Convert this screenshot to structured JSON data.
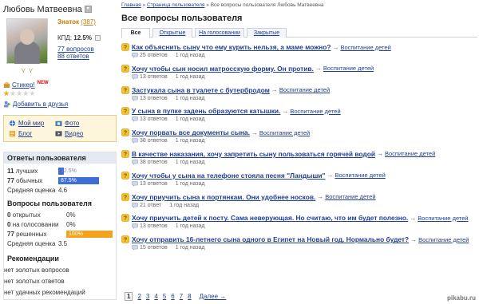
{
  "user": {
    "name": "Любовь Матвеевна",
    "rank": "Знаток",
    "points": "(387)",
    "kpd_label": "КПД:",
    "kpd_value": "12.5%",
    "questions_link": "77 вопросов",
    "answers_link": "88 ответов",
    "sticker_label": "Стикер!",
    "new_badge": "NEW",
    "rating_stars": 1,
    "rating_max": 5,
    "add_friend": "Добавить в друзья"
  },
  "links": [
    {
      "label": "Мой мир",
      "icon": "world-icon"
    },
    {
      "label": "Фото",
      "icon": "photo-icon"
    },
    {
      "label": "Блог",
      "icon": "blog-icon"
    },
    {
      "label": "Видео",
      "icon": "video-icon"
    }
  ],
  "answers_stats": {
    "heading": "Ответы пользователя",
    "rows": [
      {
        "count": "11",
        "label": "лучших",
        "pct": "12.5%",
        "fraction": 0.125,
        "color": "#3c6ed6"
      },
      {
        "count": "77",
        "label": "обычных",
        "pct": "87.5%",
        "fraction": 0.875,
        "color": "#3c6ed6"
      }
    ],
    "avg_label": "Средняя оценка",
    "avg_value": "4.6"
  },
  "questions_stats": {
    "heading": "Вопросы пользователя",
    "rows": [
      {
        "count": "0",
        "label": "открытых",
        "value": "0%",
        "fraction": 0
      },
      {
        "count": "0",
        "label": "на голосовании",
        "value": "0%",
        "fraction": 0
      },
      {
        "count": "77",
        "label": "решенных",
        "value": "100%",
        "fraction": 1.0,
        "color": "#f5a21b"
      }
    ],
    "avg_label": "Средняя оценка",
    "avg_value": "3.5"
  },
  "recommendations": {
    "heading": "Рекомендации",
    "lines": [
      "нет золотых вопросов",
      "нет золотых ответов",
      "нет удачных рекомендаций"
    ]
  },
  "breadcrumb": [
    "Главная",
    "Страница пользователя",
    "Все вопросы пользователя Любовь Матвеевна"
  ],
  "breadcrumb_sep": "»",
  "page_title": "Все вопросы пользователя",
  "tabs": [
    {
      "label": "Все",
      "active": true
    },
    {
      "label": "Открытые",
      "active": false
    },
    {
      "label": "На голосовании",
      "active": false
    },
    {
      "label": "Закрытые",
      "active": false
    }
  ],
  "questions": [
    {
      "title": "Как объяснить сыну что ему курить нельзя, а маме можно?",
      "category": "Воспитание детей",
      "answers": "25 ответов",
      "when": "1 год назад"
    },
    {
      "title": "Хочу чтобы сын носил матросскую форму. Он против.",
      "category": "Воспитание детей",
      "answers": "13 ответов",
      "when": "1 год назад"
    },
    {
      "title": "Застукала сына в туалете с бутербродом",
      "category": "Воспитание детей",
      "answers": "13 ответов",
      "when": "1 год назад"
    },
    {
      "title": "У сына в пупке задень образуются катышки.",
      "category": "Воспитание детей",
      "answers": "13 ответов",
      "when": "1 год назад"
    },
    {
      "title": "Хочу порвать все документы сына.",
      "category": "Воспитание детей",
      "answers": "38 ответов",
      "when": "1 год назад"
    },
    {
      "title": "В качестве наказания, хочу запретить сыну пользоваться горячей водой",
      "category": "Воспитание детей",
      "answers": "38 ответов",
      "when": "1 год назад"
    },
    {
      "title": "Хочу чтобы у сына на телефоне стояла песня \"Ландыши\"",
      "category": "Воспитание детей",
      "answers": "13 ответов",
      "when": "1 год назад"
    },
    {
      "title": "Хочу приучить сына к портянкам. Они удобнее носков.",
      "category": "Воспитание детей",
      "answers": "21 ответ",
      "when": "1 год назад"
    },
    {
      "title": "Хочу приучить детей к посту. Сама неверующая. Но считаю, что им будет полезно.",
      "category": "Воспитание детей",
      "answers": "13 ответов",
      "when": "1 год назад"
    },
    {
      "title": "Хочу отправить 16-летнего сына одного в Египет на Новый год. Нормально будет?",
      "category": "Воспитание детей",
      "answers": "15 ответов",
      "when": "1 год назад"
    }
  ],
  "arrow": "→",
  "pager": {
    "pages": [
      "1",
      "2",
      "3",
      "4",
      "5",
      "6",
      "7",
      "8"
    ],
    "current": "1",
    "next": "Далее →"
  },
  "watermark": "pikabu.ru",
  "colors": {
    "link": "#1f3f8f",
    "accent_blue": "#3c6ed6",
    "accent_orange": "#f5a21b",
    "panel_bg": "#e4e9f2",
    "links_box_bg": "#fdf6dc"
  }
}
